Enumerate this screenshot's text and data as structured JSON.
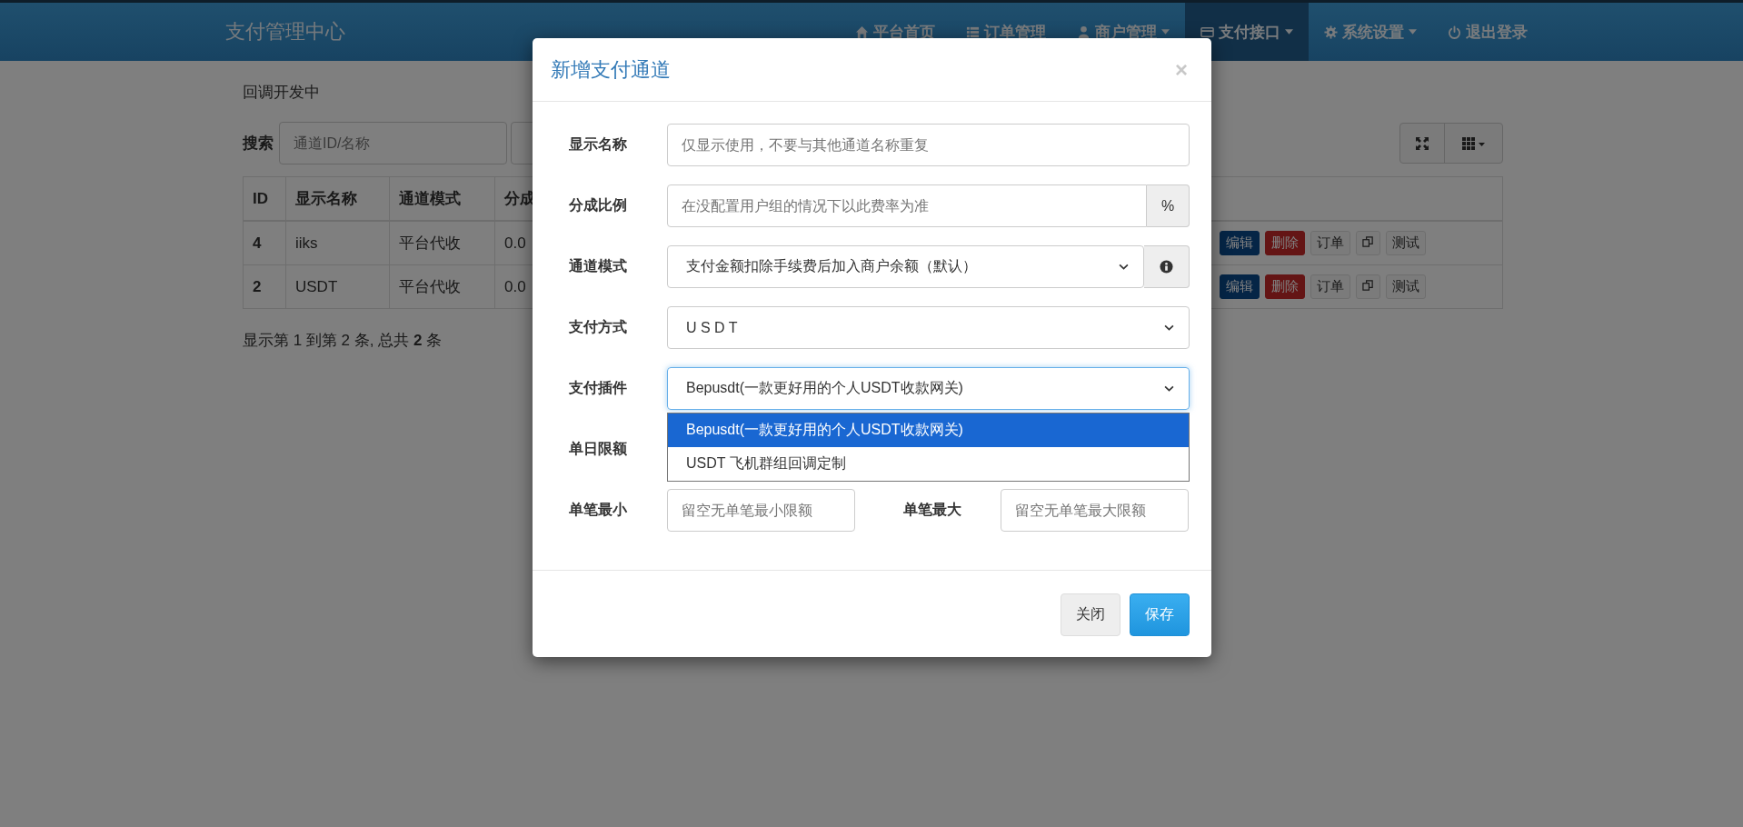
{
  "navbar": {
    "brand": "支付管理中心",
    "items": [
      {
        "label": "平台首页",
        "dropdown": false,
        "selected": false
      },
      {
        "label": "订单管理",
        "dropdown": false,
        "selected": false
      },
      {
        "label": "商户管理",
        "dropdown": true,
        "selected": false
      },
      {
        "label": "支付接口",
        "dropdown": true,
        "selected": true
      },
      {
        "label": "系统设置",
        "dropdown": true,
        "selected": false
      },
      {
        "label": "退出登录",
        "dropdown": false,
        "selected": false
      }
    ]
  },
  "page": {
    "notice": "回调开发中",
    "search": {
      "label": "搜索",
      "placeholder": "通道ID/名称"
    },
    "table": {
      "columns": [
        "ID",
        "显示名称",
        "通道模式",
        "分成"
      ],
      "rows": [
        {
          "cells": [
            "4",
            "iiks",
            "平台代收",
            "0.0"
          ],
          "actions": [
            {
              "kind": "primary",
              "label": "编辑"
            },
            {
              "kind": "danger",
              "label": "删除"
            },
            {
              "kind": "default",
              "label": "订单"
            },
            {
              "kind": "copy"
            },
            {
              "kind": "default",
              "label": "测试"
            }
          ]
        },
        {
          "cells": [
            "2",
            "USDT",
            "平台代收",
            "0.0"
          ],
          "actions": [
            {
              "kind": "primary",
              "label": "编辑"
            },
            {
              "kind": "danger",
              "label": "删除"
            },
            {
              "kind": "default",
              "label": "订单"
            },
            {
              "kind": "copy"
            },
            {
              "kind": "default",
              "label": "测试"
            }
          ]
        }
      ]
    },
    "pagination": "显示第 1 到第 2 条, 总共 **2** 条"
  },
  "modal": {
    "title": "新增支付通道",
    "close": "×",
    "fields": [
      {
        "kind": "input",
        "label": "显示名称",
        "placeholder": "仅显示使用，不要与其他通道名称重复"
      },
      {
        "kind": "input_addon",
        "label": "分成比例",
        "placeholder": "在没配置用户组的情况下以此费率为准",
        "addon": "%"
      },
      {
        "kind": "select_info",
        "label": "通道模式",
        "value": "支付金额扣除手续费后加入商户余额（默认）"
      },
      {
        "kind": "select",
        "label": "支付方式",
        "value": "U S D T"
      },
      {
        "kind": "select_open",
        "label": "支付插件",
        "value": "Bepusdt(一款更好用的个人USDT收款网关)",
        "options": [
          {
            "label": "Bepusdt(一款更好用的个人USDT收款网关)",
            "selected": true
          },
          {
            "label": "USDT 飞机群组回调定制",
            "selected": false
          }
        ]
      },
      {
        "kind": "covered",
        "label": "单日限额"
      },
      {
        "kind": "pair",
        "label": "单笔最小",
        "placeholder": "留空无单笔最小限额",
        "label2": "单笔最大",
        "placeholder2": "留空无单笔最大限额"
      }
    ],
    "buttons": [
      {
        "kind": "default",
        "label": "关闭"
      },
      {
        "kind": "primary",
        "label": "保存"
      }
    ]
  }
}
